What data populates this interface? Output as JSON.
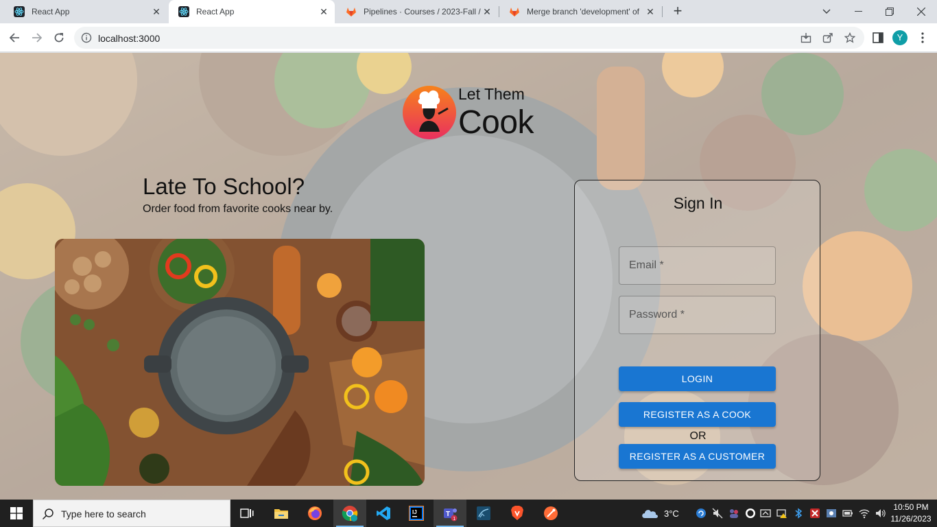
{
  "browser": {
    "tabs": [
      {
        "title": "React App",
        "active": false
      },
      {
        "title": "React App",
        "active": true
      },
      {
        "title": "Pipelines · Courses / 2023-Fall / (",
        "active": false
      },
      {
        "title": "Merge branch 'development' of",
        "active": false
      }
    ],
    "url": "localhost:3000",
    "profile_initial": "Y"
  },
  "page": {
    "brand_line1": "Let Them",
    "brand_line2": "Cook",
    "hero_title": "Late To School?",
    "hero_subtitle": "Order food from favorite cooks near by.",
    "signin": {
      "title": "Sign In",
      "email_placeholder": "Email *",
      "password_placeholder": "Password *",
      "login_label": "LOGIN",
      "register_cook_label": "REGISTER AS A COOK",
      "or_label": "OR",
      "register_customer_label": "REGISTER AS A CUSTOMER"
    }
  },
  "taskbar": {
    "search_placeholder": "Type here to search",
    "weather": "3°C",
    "time": "10:50 PM",
    "date": "11/26/2023"
  },
  "colors": {
    "primary_button": "#1976d2",
    "logo_gradient_top": "#f7821b",
    "logo_gradient_bottom": "#e9305f"
  }
}
